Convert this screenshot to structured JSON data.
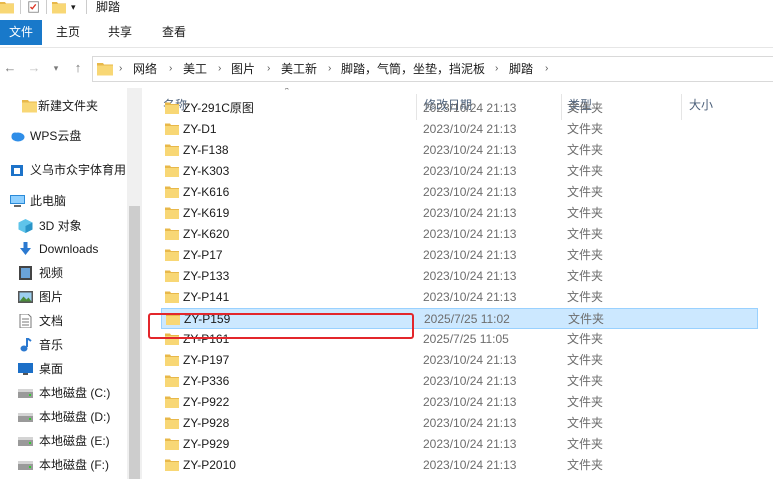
{
  "window": {
    "title": "脚踏"
  },
  "ribbon": {
    "tabs": [
      "文件",
      "主页",
      "共享",
      "查看"
    ]
  },
  "breadcrumb": [
    "网络",
    "美工",
    "图片",
    "美工新",
    "脚踏，气筒，坐垫，挡泥板",
    "脚踏"
  ],
  "nav": {
    "items": [
      {
        "label": "新建文件夹",
        "icon": "folder-icon"
      },
      {
        "label": "WPS云盘",
        "icon": "cloud-icon"
      },
      {
        "label": "义乌市众宇体育用",
        "icon": "box-icon"
      },
      {
        "label": "此电脑",
        "icon": "computer-icon"
      },
      {
        "label": "3D 对象",
        "icon": "cube-icon"
      },
      {
        "label": "Downloads",
        "icon": "download-icon"
      },
      {
        "label": "视频",
        "icon": "video-icon"
      },
      {
        "label": "图片",
        "icon": "picture-icon"
      },
      {
        "label": "文档",
        "icon": "document-icon"
      },
      {
        "label": "音乐",
        "icon": "music-icon"
      },
      {
        "label": "桌面",
        "icon": "desktop-icon"
      },
      {
        "label": "本地磁盘 (C:)",
        "icon": "drive-icon"
      },
      {
        "label": "本地磁盘 (D:)",
        "icon": "drive-icon"
      },
      {
        "label": "本地磁盘 (E:)",
        "icon": "drive-icon"
      },
      {
        "label": "本地磁盘 (F:)",
        "icon": "drive-icon"
      }
    ]
  },
  "columns": {
    "name": "名称",
    "date": "修改日期",
    "type": "类型",
    "size": "大小"
  },
  "files": [
    {
      "name": "ZY-291C原图",
      "date": "2023/10/24 21:13",
      "type": "文件夹"
    },
    {
      "name": "ZY-D1",
      "date": "2023/10/24 21:13",
      "type": "文件夹"
    },
    {
      "name": "ZY-F138",
      "date": "2023/10/24 21:13",
      "type": "文件夹"
    },
    {
      "name": "ZY-K303",
      "date": "2023/10/24 21:13",
      "type": "文件夹"
    },
    {
      "name": "ZY-K616",
      "date": "2023/10/24 21:13",
      "type": "文件夹"
    },
    {
      "name": "ZY-K619",
      "date": "2023/10/24 21:13",
      "type": "文件夹"
    },
    {
      "name": "ZY-K620",
      "date": "2023/10/24 21:13",
      "type": "文件夹"
    },
    {
      "name": "ZY-P17",
      "date": "2023/10/24 21:13",
      "type": "文件夹"
    },
    {
      "name": "ZY-P133",
      "date": "2023/10/24 21:13",
      "type": "文件夹"
    },
    {
      "name": "ZY-P141",
      "date": "2023/10/24 21:13",
      "type": "文件夹"
    },
    {
      "name": "ZY-P159",
      "date": "2025/7/25 11:02",
      "type": "文件夹",
      "selected": true
    },
    {
      "name": "ZY-P161",
      "date": "2025/7/25 11:05",
      "type": "文件夹"
    },
    {
      "name": "ZY-P197",
      "date": "2023/10/24 21:13",
      "type": "文件夹"
    },
    {
      "name": "ZY-P336",
      "date": "2023/10/24 21:13",
      "type": "文件夹"
    },
    {
      "name": "ZY-P922",
      "date": "2023/10/24 21:13",
      "type": "文件夹"
    },
    {
      "name": "ZY-P928",
      "date": "2023/10/24 21:13",
      "type": "文件夹"
    },
    {
      "name": "ZY-P929",
      "date": "2023/10/24 21:13",
      "type": "文件夹"
    },
    {
      "name": "ZY-P2010",
      "date": "2023/10/24 21:13",
      "type": "文件夹"
    }
  ],
  "colors": {
    "accent": "#1979ca",
    "selection": "#cce8ff",
    "highlight": "#e3262b",
    "folder": "#f8d775"
  }
}
